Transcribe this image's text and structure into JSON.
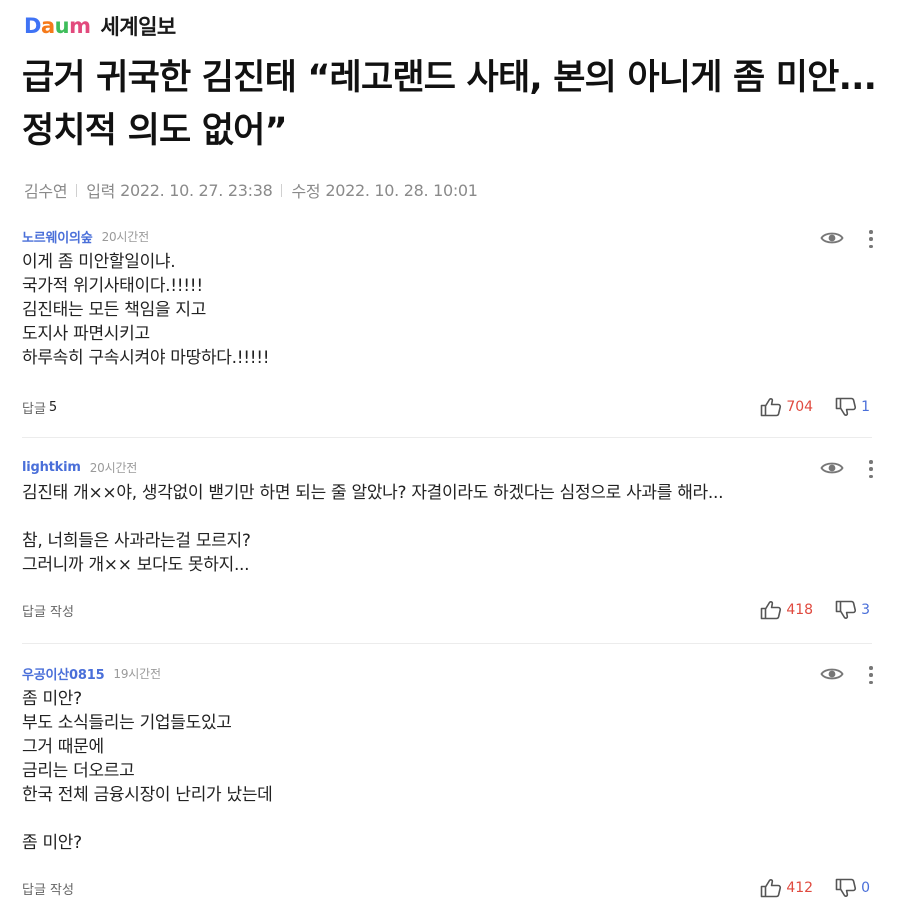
{
  "header": {
    "logo_parts": [
      "D",
      "a",
      "u",
      "m"
    ],
    "press": "세계일보"
  },
  "article": {
    "title": "급거 귀국한 김진태 “레고랜드 사태, 본의 아니게 좀 미안... 정치적 의도 없어”",
    "author": "김수연",
    "input_label": "입력",
    "input_date": "2022. 10. 27. 23:38",
    "edit_label": "수정",
    "edit_date": "2022. 10. 28. 10:01"
  },
  "colors": {
    "username": "#4a6fd9",
    "like": "#e04a3f",
    "dislike": "#4a6fd9"
  },
  "comments": [
    {
      "user": "노르웨이의숲",
      "time": "20시간전",
      "body": "이게 좀 미안할일이냐.\n국가적 위기사태이다.!!!!!\n김진태는 모든 책임을 지고\n도지사 파면시키고\n하루속히 구속시켜야 마땅하다.!!!!!",
      "reply_label": "답글",
      "reply_count": "5",
      "likes": "704",
      "dislikes": "1"
    },
    {
      "user": "lightkim",
      "time": "20시간전",
      "body": "김진태 개××야, 생각없이 밷기만 하면 되는 줄 알았나?  자결이라도 하겠다는  심정으로 사과를 해라...\n\n참, 너희들은 사과라는걸 모르지?\n그러니까 개×× 보다도 못하지...",
      "reply_label": "답글 작성",
      "reply_count": "",
      "likes": "418",
      "dislikes": "3"
    },
    {
      "user": "우공이산0815",
      "time": "19시간전",
      "body": "좀 미안?\n부도 소식들리는 기업들도있고\n그거 때문에\n금리는 더오르고\n한국 전체 금융시장이 난리가 났는데\n\n좀 미안?",
      "reply_label": "답글 작성",
      "reply_count": "",
      "likes": "412",
      "dislikes": "0"
    }
  ]
}
